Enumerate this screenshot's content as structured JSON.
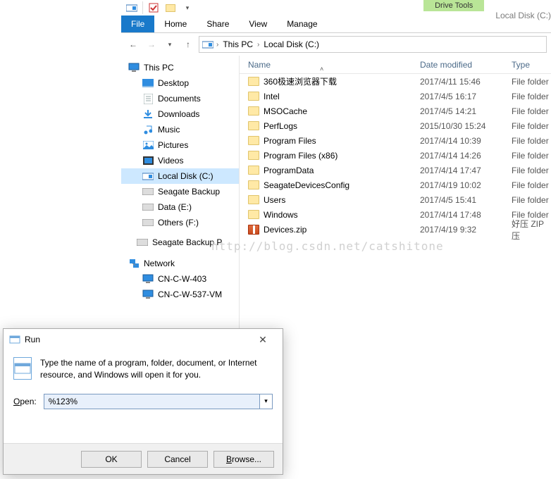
{
  "explorer": {
    "contextual_tab_group": "Drive Tools",
    "location_label": "Local Disk (C:)",
    "tabs": {
      "file": "File",
      "home": "Home",
      "share": "Share",
      "view": "View",
      "manage": "Manage"
    },
    "breadcrumb": {
      "root": "This PC",
      "current": "Local Disk (C:)"
    },
    "tree": {
      "this_pc": "This PC",
      "desktop": "Desktop",
      "documents": "Documents",
      "downloads": "Downloads",
      "music": "Music",
      "pictures": "Pictures",
      "videos": "Videos",
      "c_drive": "Local Disk (C:)",
      "seagate_backup": "Seagate Backup",
      "data_e": "Data (E:)",
      "others_f": "Others (F:)",
      "seagate_backup_p": "Seagate Backup P",
      "network": "Network",
      "net1": "CN-C-W-403",
      "net2": "CN-C-W-537-VM"
    },
    "columns": {
      "name": "Name",
      "date": "Date modified",
      "type": "Type"
    },
    "files": [
      {
        "name": "360极速浏览器下载",
        "date": "2017/4/11 15:46",
        "type": "File folder",
        "kind": "folder"
      },
      {
        "name": "Intel",
        "date": "2017/4/5 16:17",
        "type": "File folder",
        "kind": "folder"
      },
      {
        "name": "MSOCache",
        "date": "2017/4/5 14:21",
        "type": "File folder",
        "kind": "folder"
      },
      {
        "name": "PerfLogs",
        "date": "2015/10/30 15:24",
        "type": "File folder",
        "kind": "folder"
      },
      {
        "name": "Program Files",
        "date": "2017/4/14 10:39",
        "type": "File folder",
        "kind": "folder"
      },
      {
        "name": "Program Files (x86)",
        "date": "2017/4/14 14:26",
        "type": "File folder",
        "kind": "folder"
      },
      {
        "name": "ProgramData",
        "date": "2017/4/14 17:47",
        "type": "File folder",
        "kind": "folder"
      },
      {
        "name": "SeagateDevicesConfig",
        "date": "2017/4/19 10:02",
        "type": "File folder",
        "kind": "folder"
      },
      {
        "name": "Users",
        "date": "2017/4/5 15:41",
        "type": "File folder",
        "kind": "folder"
      },
      {
        "name": "Windows",
        "date": "2017/4/14 17:48",
        "type": "File folder",
        "kind": "folder"
      },
      {
        "name": "Devices.zip",
        "date": "2017/4/19 9:32",
        "type": "好压 ZIP 压",
        "kind": "zip"
      }
    ]
  },
  "watermark": "http://blog.csdn.net/catshitone",
  "run": {
    "title": "Run",
    "desc": "Type the name of a program, folder, document, or Internet resource, and Windows will open it for you.",
    "open_label": "Open:",
    "open_accesskey": "O",
    "value": "%123%",
    "buttons": {
      "ok": "OK",
      "cancel": "Cancel",
      "browse": "Browse...",
      "browse_accesskey": "B"
    }
  }
}
